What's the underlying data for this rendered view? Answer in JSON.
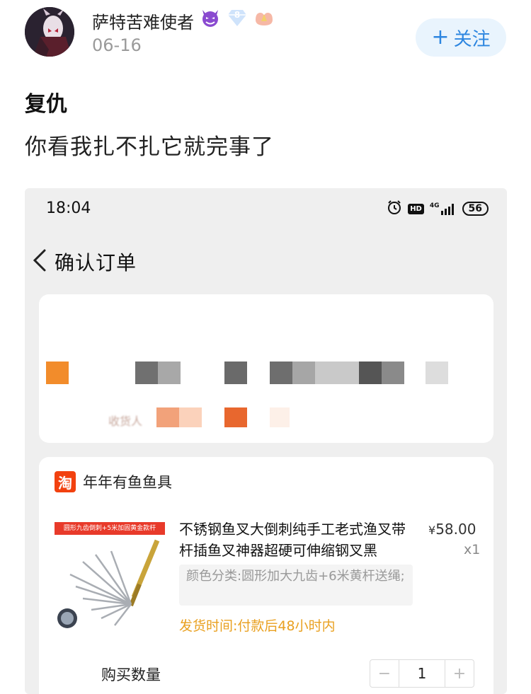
{
  "post": {
    "author_name": "萨特苦难使者",
    "date": "06-16",
    "follow_label": "关注",
    "follow_plus": "+",
    "title": "复仇",
    "body": "你看我扎不扎它就完事了",
    "badges": [
      "devil-emoji-icon",
      "diamond-level-badge-icon",
      "vip-hands-badge-icon"
    ],
    "level_badge": "8",
    "accent": "#2d86e0"
  },
  "screenshot": {
    "status_time": "18:04",
    "status_icons": [
      "alarm-icon",
      "hd-icon",
      "signal-4g-icon"
    ],
    "network_label": "4G",
    "hd_label": "HD",
    "battery": "56",
    "nav_title": "确认订单",
    "address_label": "收货人",
    "shop": {
      "icon_char": "淘",
      "name": "年年有鱼鱼具"
    },
    "product": {
      "banner": "圆形九齿倒刺+5米加固黄金款杆",
      "title": "不锈钢鱼叉大倒刺纯手工老式渔叉带杆插鱼叉神器超硬可伸缩钢叉黑",
      "price_symbol": "¥",
      "price": "58.00",
      "quantity": "x1",
      "sku": "颜色分类:圆形加大九齿+6米黄杆送绳;",
      "ship_time": "发货时间:付款后48小时内"
    },
    "purchase": {
      "label": "购买数量",
      "minus": "−",
      "value": "1",
      "plus": "+"
    },
    "colors": {
      "taobao_orange": "#f2410f",
      "ship_time": "#e9a020",
      "card_bg": "#ffffff",
      "page_bg": "#efefef"
    }
  }
}
